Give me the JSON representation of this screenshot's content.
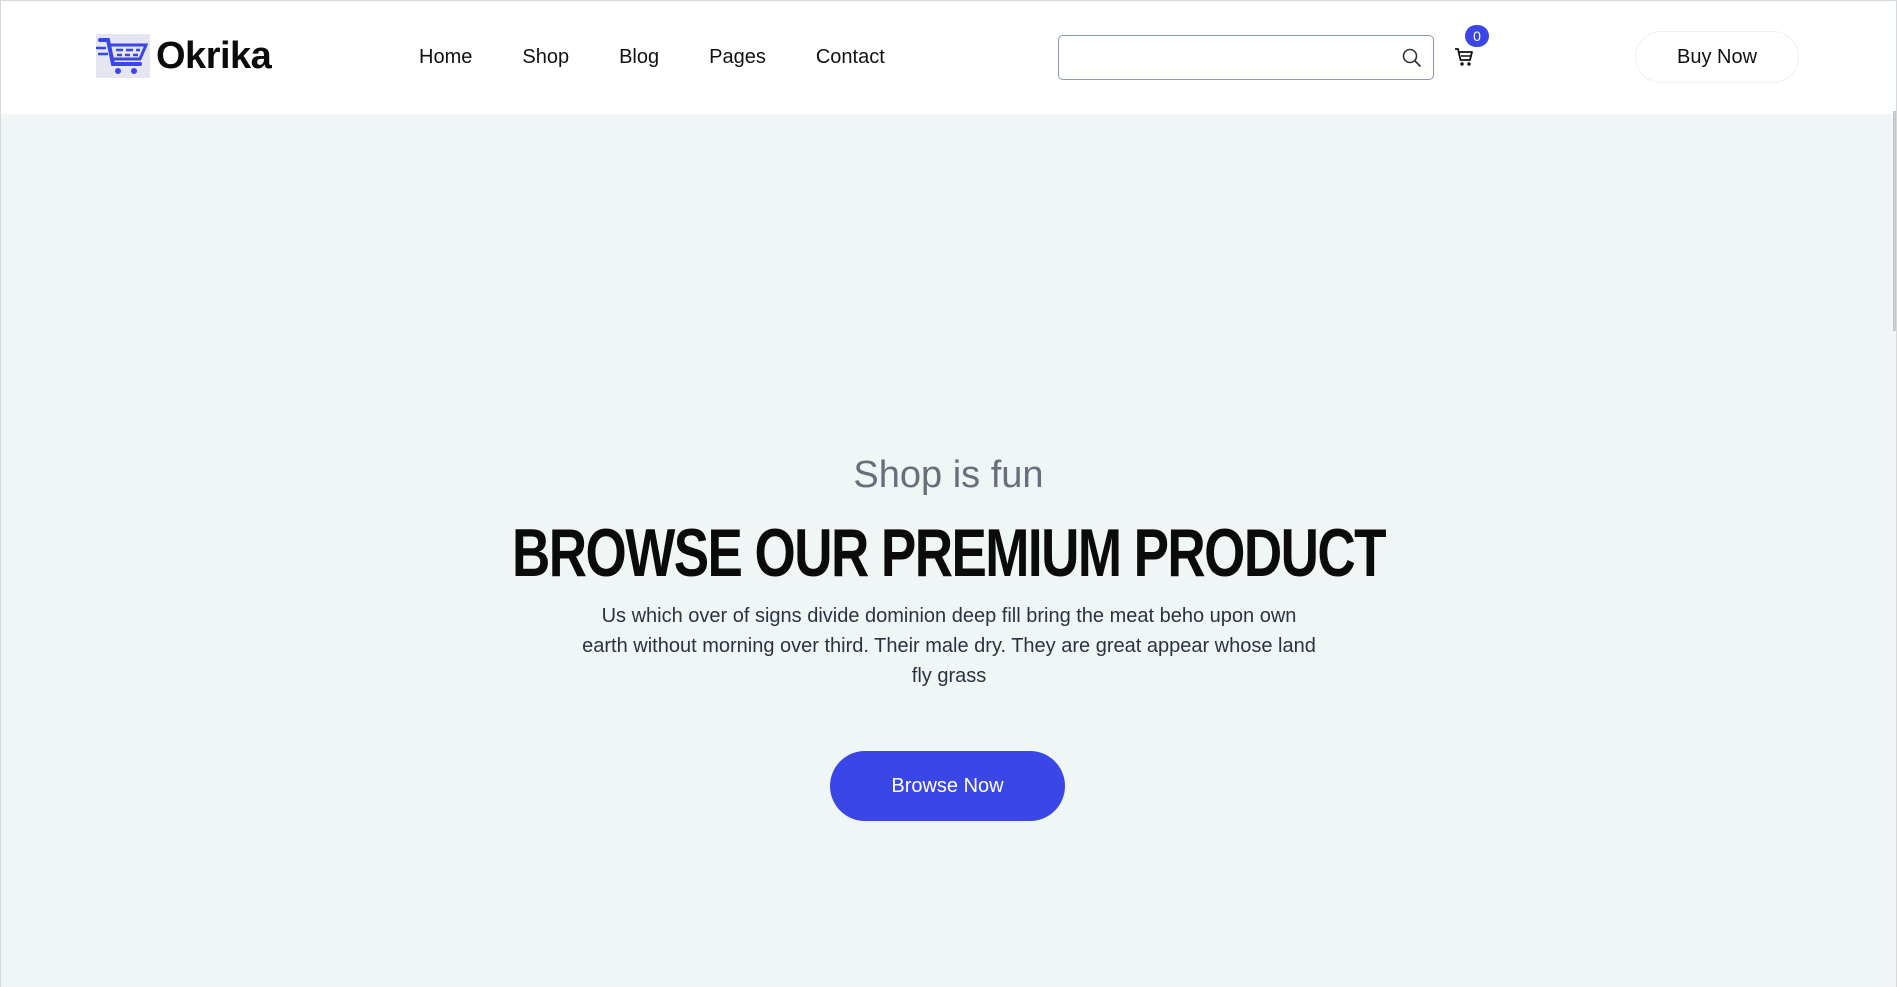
{
  "brand": {
    "name": "Okrika",
    "logo_icon": "cart-logo-icon"
  },
  "nav": {
    "items": [
      {
        "label": "Home"
      },
      {
        "label": "Shop"
      },
      {
        "label": "Blog"
      },
      {
        "label": "Pages"
      },
      {
        "label": "Contact"
      }
    ]
  },
  "search": {
    "value": "",
    "placeholder": "",
    "icon": "search-icon"
  },
  "cart": {
    "icon": "cart-icon",
    "count": "0"
  },
  "header": {
    "buy_label": "Buy Now"
  },
  "hero": {
    "subtitle": "Shop is fun",
    "title": "BROWSE OUR PREMIUM PRODUCT",
    "description": "Us which over of signs divide dominion deep fill bring the meat beho upon own earth without morning over third. Their male dry. They are great appear whose land fly grass",
    "cta_label": "Browse Now"
  },
  "colors": {
    "accent": "#3a46e6",
    "hero_bg": "#f0f5f5",
    "subtitle": "#676f7d"
  }
}
